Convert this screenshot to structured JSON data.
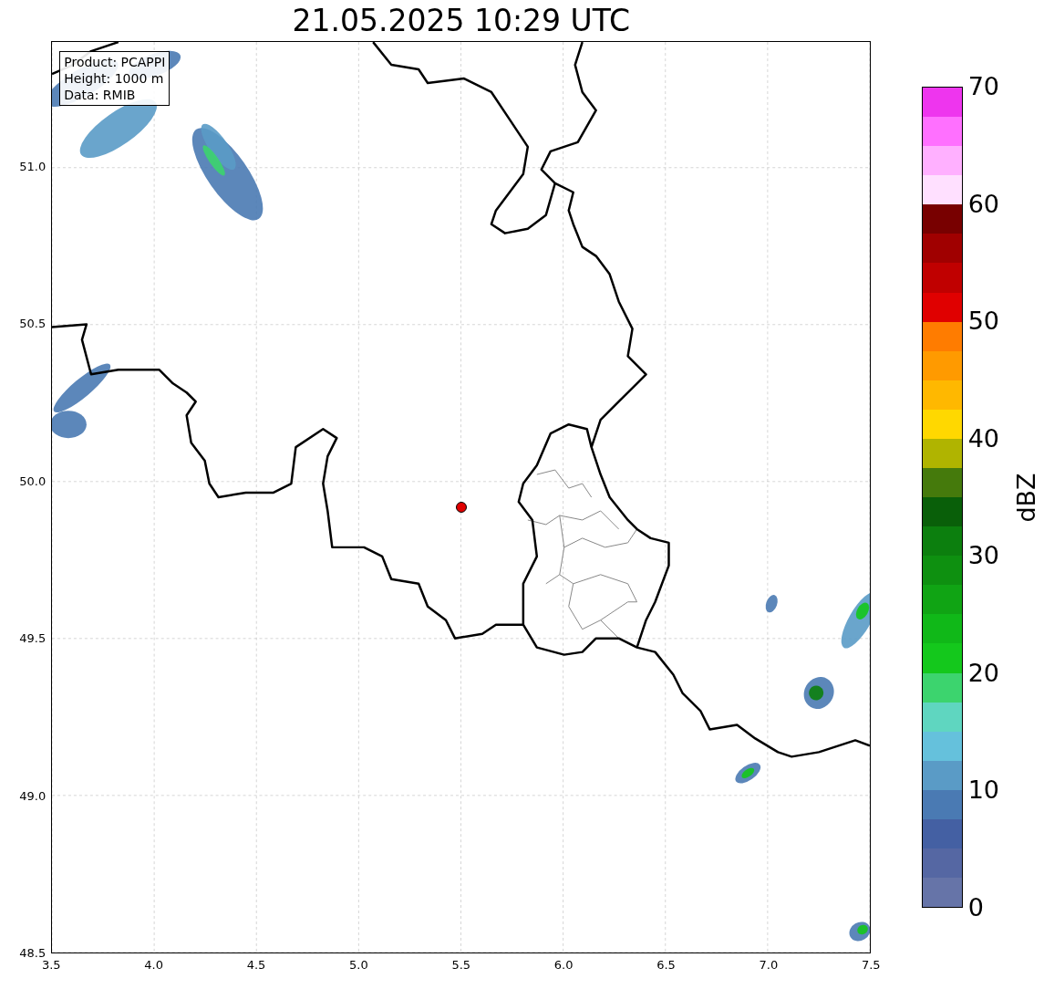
{
  "title": "21.05.2025 10:29 UTC",
  "map": {
    "info_box": [
      "Product: PCAPPI",
      "Height: 1000 m",
      "Data: RMIB"
    ],
    "y_axis": {
      "ticks": [
        "51.0",
        "50.5",
        "50.0",
        "49.5",
        "49.0",
        "48.5"
      ]
    },
    "x_axis": {
      "ticks": [
        "3.5",
        "4.0",
        "4.5",
        "5.0",
        "5.5",
        "6.0",
        "6.5",
        "7.0",
        "7.5"
      ]
    }
  },
  "colorbar": {
    "ticks": [
      "70",
      "60",
      "50",
      "40",
      "30",
      "20",
      "10",
      "0"
    ],
    "bands": [
      {
        "color": "#ee35ee"
      },
      {
        "color": "#ff70ff"
      },
      {
        "color": "#ffb0ff"
      },
      {
        "color": "#ffe0ff"
      },
      {
        "color": "#780000"
      },
      {
        "color": "#a00000"
      },
      {
        "color": "#c00000"
      },
      {
        "color": "#e00000"
      },
      {
        "color": "#ff7c00"
      },
      {
        "color": "#ff9a00"
      },
      {
        "color": "#ffb800"
      },
      {
        "color": "#ffd800"
      },
      {
        "color": "#b0b400"
      },
      {
        "color": "#457a0c"
      },
      {
        "color": "#095f09"
      },
      {
        "color": "#0c7f0e"
      },
      {
        "color": "#0e9010"
      },
      {
        "color": "#10a414"
      },
      {
        "color": "#10b818"
      },
      {
        "color": "#14c81c"
      },
      {
        "color": "#3cd46e"
      },
      {
        "color": "#5fd6c0"
      },
      {
        "color": "#65c1dc"
      },
      {
        "color": "#5a9bc6"
      },
      {
        "color": "#4a7ab3"
      },
      {
        "color": "#4460a3"
      },
      {
        "color": "#5567a3"
      },
      {
        "color": "#6674a8"
      }
    ],
    "label": "dBZ"
  }
}
